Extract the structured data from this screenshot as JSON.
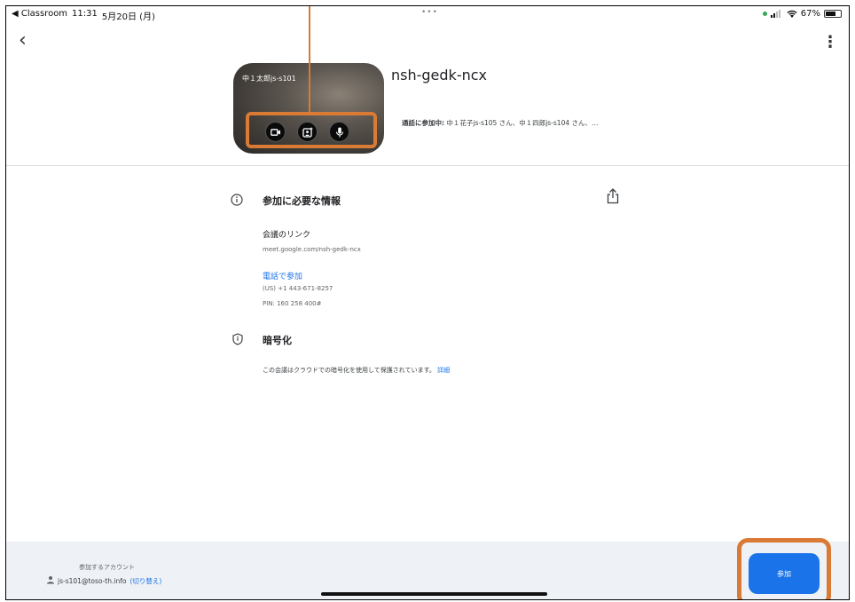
{
  "status_bar": {
    "back_app": "◀ Classroom",
    "time": "11:31",
    "date": "5月20日 (月)",
    "center_dots": "•••",
    "battery": "67%"
  },
  "preview": {
    "user_label": "中１太郎js-s101",
    "controls": [
      "camera-icon",
      "effects-icon",
      "mic-icon"
    ]
  },
  "meeting": {
    "code": "nsh-gedk-ncx",
    "in_call_label": "通話に参加中:",
    "in_call_names": "中１花子js-s105 さん、中１四郎js-s104 さん、…"
  },
  "join_info": {
    "title": "参加に必要な情報",
    "link_label": "会議のリンク",
    "link_url": "meet.google.com/nsh-gedk-ncx",
    "phone_label": "電話で参加",
    "phone_number": "(US) +1 443-671-8257",
    "pin": "PIN: 160 258 400#"
  },
  "encryption": {
    "title": "暗号化",
    "description": "この会議はクラウドでの暗号化を使用して保護されています。",
    "details_link": "詳細"
  },
  "footer": {
    "account_label": "参加するアカウント",
    "email": "js-s101@toso-th.info",
    "switch_label": "(切り替え)",
    "join_button": "参加"
  },
  "colors": {
    "accent": "#1a73e8",
    "highlight": "#d97a35",
    "footer_bg": "#eef1f6"
  }
}
